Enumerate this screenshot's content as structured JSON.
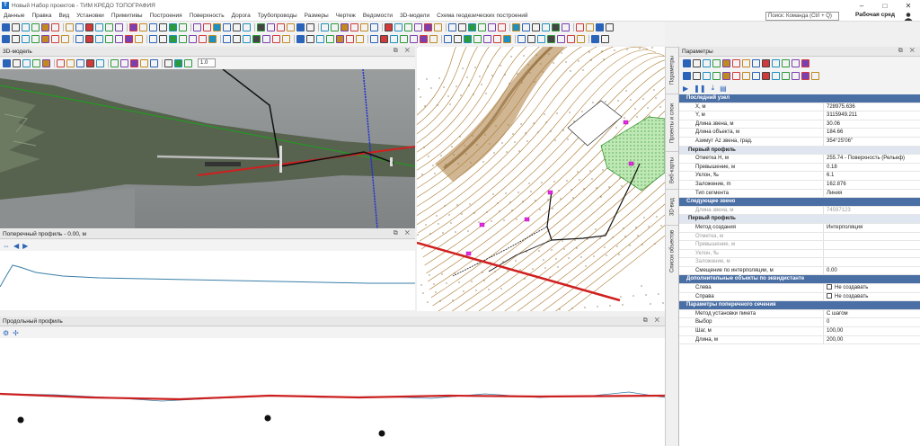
{
  "app": {
    "title": "Новый Набор проектов - ТИМ КРЕДО ТОПОГРАФИЯ"
  },
  "menu": [
    "Данные",
    "Правка",
    "Вид",
    "Установки",
    "Примитивы",
    "Построения",
    "Поверхность",
    "Дорога",
    "Трубопроводы",
    "Размеры",
    "Чертеж",
    "Ведомости",
    "3D-модели",
    "Схема геодезических построений"
  ],
  "search": {
    "placeholder": "Поиск: Команда (Ctrl + Q)"
  },
  "workspace": "Рабочая сред",
  "panels": {
    "model3d": "3D-модель",
    "cross": "Поперечный профиль - 0.00, м",
    "longitudinal": "Продольный профиль",
    "params": "Параметры",
    "zoom_value": "1.0"
  },
  "vertical_tabs": [
    "Параметры",
    "Проекты и слои",
    "Веб-карты",
    "3D-вид",
    "Список объектов"
  ],
  "params": {
    "rows": [
      {
        "type": "sec",
        "k": "Последний узел"
      },
      {
        "type": "row",
        "k": "X, м",
        "v": "728975.636"
      },
      {
        "type": "row",
        "k": "Y, м",
        "v": "3115949.211"
      },
      {
        "type": "row",
        "k": "Длина звена, м",
        "v": "30.06"
      },
      {
        "type": "row",
        "k": "Длина объекта, м",
        "v": "184.66"
      },
      {
        "type": "row",
        "k": "Азимут Az звена, град.",
        "v": "354°25'06\""
      },
      {
        "type": "sub",
        "k": "Первый профиль"
      },
      {
        "type": "row",
        "k": "Отметка H, м",
        "v": "255.74 - Поверхность (Рельеф)"
      },
      {
        "type": "row",
        "k": "Превышение, м",
        "v": "0.18"
      },
      {
        "type": "row",
        "k": "Уклон, ‰",
        "v": "6.1"
      },
      {
        "type": "row",
        "k": "Заложение, m",
        "v": "162.876"
      },
      {
        "type": "row",
        "k": "Тип сегмента",
        "v": "Линия"
      },
      {
        "type": "sec",
        "k": "Следующее звено"
      },
      {
        "type": "dim",
        "k": "Длина звена, м",
        "v": "74597123"
      },
      {
        "type": "sub",
        "k": "Первый профиль"
      },
      {
        "type": "row",
        "k": "Метод создания",
        "v": "Интерполяция"
      },
      {
        "type": "dim",
        "k": "Отметка, м",
        "v": ""
      },
      {
        "type": "dim",
        "k": "Превышение, м",
        "v": ""
      },
      {
        "type": "dim",
        "k": "Уклон, ‰",
        "v": ""
      },
      {
        "type": "dim",
        "k": "Заложение, м",
        "v": ""
      },
      {
        "type": "row",
        "k": "Смещение по интерполяции, м",
        "v": "0.00"
      },
      {
        "type": "sec",
        "k": "Дополнительные объекты по эквидистанте"
      },
      {
        "type": "cb",
        "k": "Слева",
        "v": "Не создавать"
      },
      {
        "type": "cb",
        "k": "Справа",
        "v": "Не создавать"
      },
      {
        "type": "sec",
        "k": "Параметры поперечного сечения"
      },
      {
        "type": "row",
        "k": "Метод установки пикета",
        "v": "С шагом"
      },
      {
        "type": "row",
        "k": "Выбор",
        "v": "0"
      },
      {
        "type": "row",
        "k": "Шаг, м",
        "v": "100,00"
      },
      {
        "type": "row",
        "k": "Длина, м",
        "v": "200,00"
      }
    ]
  },
  "colors": {
    "accent": "#4a6fa5",
    "terrain": "#5c6a55",
    "profile_red": "#cc1f1f",
    "contour": "#a9792f"
  }
}
